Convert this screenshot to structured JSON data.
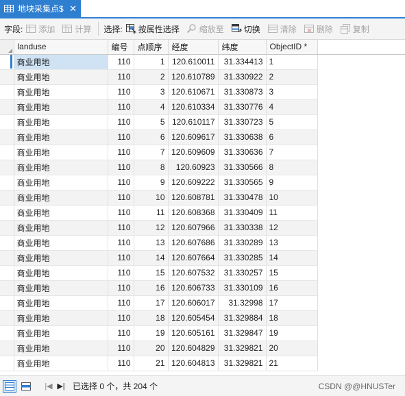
{
  "tab": {
    "title": "地块采集点$",
    "close": "✕"
  },
  "toolbar": {
    "field_label": "字段:",
    "add": "添加",
    "calculate": "计算",
    "selection_label": "选择:",
    "select_by_attr": "按属性选择",
    "zoom_to": "缩放至",
    "switch": "切换",
    "clear": "清除",
    "delete": "删除",
    "copy": "复制"
  },
  "table": {
    "columns": [
      "landuse",
      "编号",
      "点顺序",
      "经度",
      "纬度",
      "ObjectID *"
    ],
    "rows": [
      [
        "商业用地",
        "110",
        "1",
        "120.610011",
        "31.334413",
        "1"
      ],
      [
        "商业用地",
        "110",
        "2",
        "120.610789",
        "31.330922",
        "2"
      ],
      [
        "商业用地",
        "110",
        "3",
        "120.610671",
        "31.330873",
        "3"
      ],
      [
        "商业用地",
        "110",
        "4",
        "120.610334",
        "31.330776",
        "4"
      ],
      [
        "商业用地",
        "110",
        "5",
        "120.610117",
        "31.330723",
        "5"
      ],
      [
        "商业用地",
        "110",
        "6",
        "120.609617",
        "31.330638",
        "6"
      ],
      [
        "商业用地",
        "110",
        "7",
        "120.609609",
        "31.330636",
        "7"
      ],
      [
        "商业用地",
        "110",
        "8",
        "120.60923",
        "31.330566",
        "8"
      ],
      [
        "商业用地",
        "110",
        "9",
        "120.609222",
        "31.330565",
        "9"
      ],
      [
        "商业用地",
        "110",
        "10",
        "120.608781",
        "31.330478",
        "10"
      ],
      [
        "商业用地",
        "110",
        "11",
        "120.608368",
        "31.330409",
        "11"
      ],
      [
        "商业用地",
        "110",
        "12",
        "120.607966",
        "31.330338",
        "12"
      ],
      [
        "商业用地",
        "110",
        "13",
        "120.607686",
        "31.330289",
        "13"
      ],
      [
        "商业用地",
        "110",
        "14",
        "120.607664",
        "31.330285",
        "14"
      ],
      [
        "商业用地",
        "110",
        "15",
        "120.607532",
        "31.330257",
        "15"
      ],
      [
        "商业用地",
        "110",
        "16",
        "120.606733",
        "31.330109",
        "16"
      ],
      [
        "商业用地",
        "110",
        "17",
        "120.606017",
        "31.32998",
        "17"
      ],
      [
        "商业用地",
        "110",
        "18",
        "120.605454",
        "31.329884",
        "18"
      ],
      [
        "商业用地",
        "110",
        "19",
        "120.605161",
        "31.329847",
        "19"
      ],
      [
        "商业用地",
        "110",
        "20",
        "120.604829",
        "31.329821",
        "20"
      ],
      [
        "商业用地",
        "110",
        "21",
        "120.604813",
        "31.329821",
        "21"
      ]
    ]
  },
  "status": {
    "selected_text": "已选择 0 个，共 204 个",
    "watermark": "CSDN @@HNUSTer"
  },
  "colors": {
    "accent": "#2f7fd1",
    "selected_cell": "#cfe3f5",
    "alt_row": "#f3f3f3"
  }
}
